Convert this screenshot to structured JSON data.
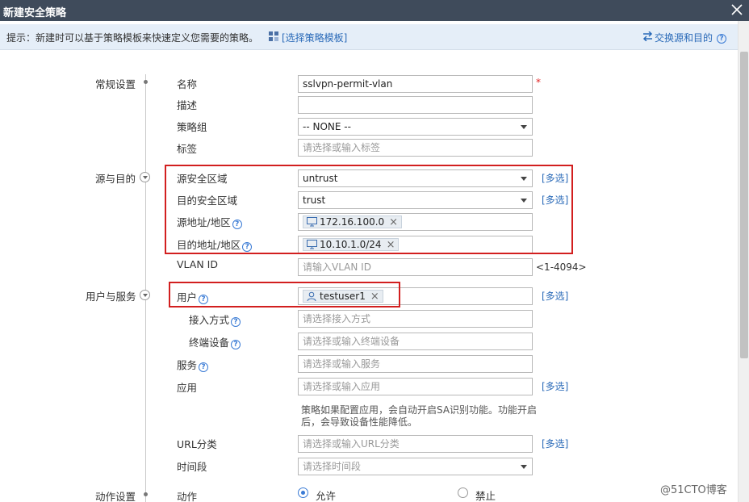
{
  "window": {
    "title": "新建安全策略"
  },
  "tip": {
    "text": "提示：新建时可以基于策略模板来快速定义您需要的策略。",
    "template_link": "[选择策略模板]",
    "swap_link": "交换源和目的"
  },
  "sections": {
    "general": "常规设置",
    "src_dst": "源与目的",
    "user_service": "用户与服务",
    "action": "动作设置"
  },
  "fields": {
    "name": {
      "label": "名称",
      "value": "sslvpn-permit-vlan",
      "required_mark": "*"
    },
    "desc": {
      "label": "描述",
      "value": ""
    },
    "group": {
      "label": "策略组",
      "value": "-- NONE --"
    },
    "tag": {
      "label": "标签",
      "placeholder": "请选择或输入标签"
    },
    "src_zone": {
      "label": "源安全区域",
      "value": "untrust",
      "multi": "[多选]"
    },
    "dst_zone": {
      "label": "目的安全区域",
      "value": "trust",
      "multi": "[多选]"
    },
    "src_addr": {
      "label": "源地址/地区",
      "tag": "172.16.100.0"
    },
    "dst_addr": {
      "label": "目的地址/地区",
      "tag": "10.10.1.0/24"
    },
    "vlan": {
      "label": "VLAN ID",
      "placeholder": "请输入VLAN ID",
      "range": "<1-4094>"
    },
    "user": {
      "label": "用户",
      "tag": "testuser1",
      "multi": "[多选]"
    },
    "access": {
      "label": "接入方式",
      "placeholder": "请选择接入方式"
    },
    "terminal": {
      "label": "终端设备",
      "placeholder": "请选择或输入终端设备"
    },
    "service": {
      "label": "服务",
      "placeholder": "请选择或输入服务"
    },
    "app": {
      "label": "应用",
      "placeholder": "请选择或输入应用",
      "multi": "[多选]",
      "note": "策略如果配置应用，会自动开启SA识别功能。功能开启后，会导致设备性能降低。"
    },
    "url": {
      "label": "URL分类",
      "placeholder": "请选择或输入URL分类",
      "multi": "[多选]"
    },
    "time": {
      "label": "时间段",
      "placeholder": "请选择时间段"
    },
    "action": {
      "label": "动作",
      "permit": "允许",
      "deny": "禁止",
      "selected": "permit"
    }
  },
  "help_mark": "?",
  "remove_mark": "×",
  "watermark": "@51CTO博客",
  "colors": {
    "titlebar": "#3f4b5b",
    "tipbar": "#e5eef8",
    "link": "#2a6ab8",
    "highlight": "#d21f1f"
  }
}
